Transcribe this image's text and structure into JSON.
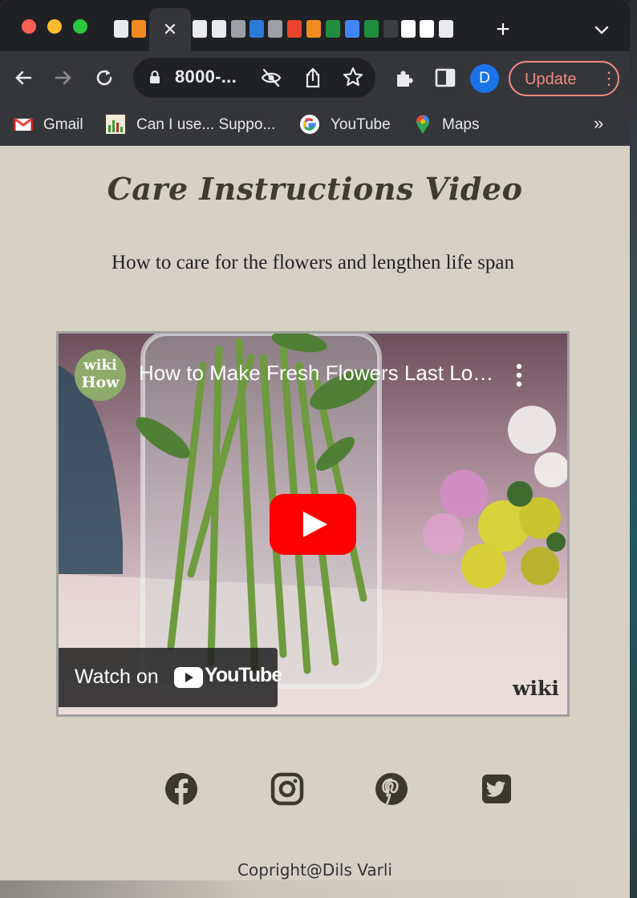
{
  "browser": {
    "close_tab_glyph": "✕",
    "new_tab_glyph": "+",
    "address": "8000-...",
    "avatar_initial": "D",
    "update_label": "Update",
    "menu_glyph": "⋮",
    "bookmarks": [
      {
        "label": "Gmail",
        "icon": "gmail-icon"
      },
      {
        "label": "Can I use... Suppo...",
        "icon": "caniuse-icon"
      },
      {
        "label": "YouTube",
        "icon": "google-icon"
      },
      {
        "label": "Maps",
        "icon": "maps-icon"
      }
    ],
    "bookmarks_more": "»"
  },
  "page": {
    "title": "Care Instructions Video",
    "subtitle": "How to care for the flowers and lengthen life span",
    "video": {
      "channel_line1": "wiki",
      "channel_line2": "How",
      "title": "How to Make Fresh Flowers Last Longer",
      "watch_label": "Watch on",
      "youtube_word": "YouTube",
      "watermark": "wiki"
    },
    "social": [
      "facebook-icon",
      "instagram-icon",
      "pinterest-icon",
      "twitter-icon"
    ],
    "copyright": "Copright@Dils Varli"
  },
  "colors": {
    "page_bg": "#d6d1c3",
    "title_color": "#3e3d2c",
    "social_color": "#3b3a2a",
    "update_accent": "#f28b82",
    "youtube_red": "#ff0000"
  }
}
